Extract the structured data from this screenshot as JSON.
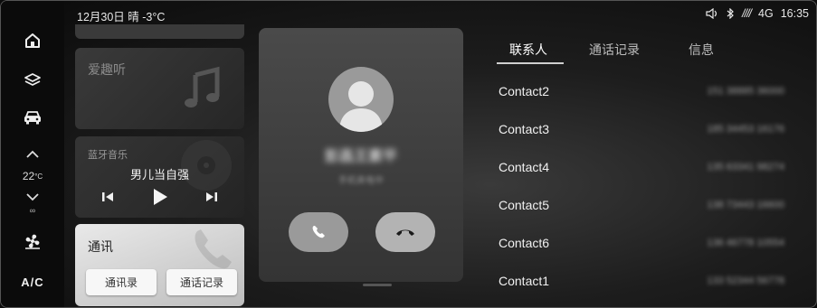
{
  "status": {
    "date_weather": "12月30日 晴 -3°C",
    "signal": "////",
    "network": "4G",
    "time": "16:35"
  },
  "rail": {
    "temperature": "22",
    "temperature_unit": "°C",
    "fan_mode": "∞",
    "ac_label": "A/C"
  },
  "cards": {
    "music_title": "爱趣听",
    "bluetooth_label": "蓝牙音乐",
    "song_title": "男儿当自强",
    "comm_title": "通讯",
    "contacts_button": "通讯录",
    "call_log_button": "通话记录"
  },
  "call": {
    "caller_name": "彭昌王素平",
    "caller_subtitle": "手机来电中"
  },
  "tabs": [
    "联系人",
    "通话记录",
    "信息"
  ],
  "contacts": [
    {
      "name": "Contact2",
      "number": "151 38885 36000"
    },
    {
      "name": "Contact3",
      "number": "185 34453 16176"
    },
    {
      "name": "Contact4",
      "number": "135 63341 98274"
    },
    {
      "name": "Contact5",
      "number": "138 73443 16600"
    },
    {
      "name": "Contact6",
      "number": "136 46778 10554"
    },
    {
      "name": "Contact1",
      "number": "133 52344 56778"
    }
  ],
  "colors": {
    "background": "#0c0c0c",
    "card": "#2d2d2d",
    "accent_light": "#e9e9e9"
  }
}
